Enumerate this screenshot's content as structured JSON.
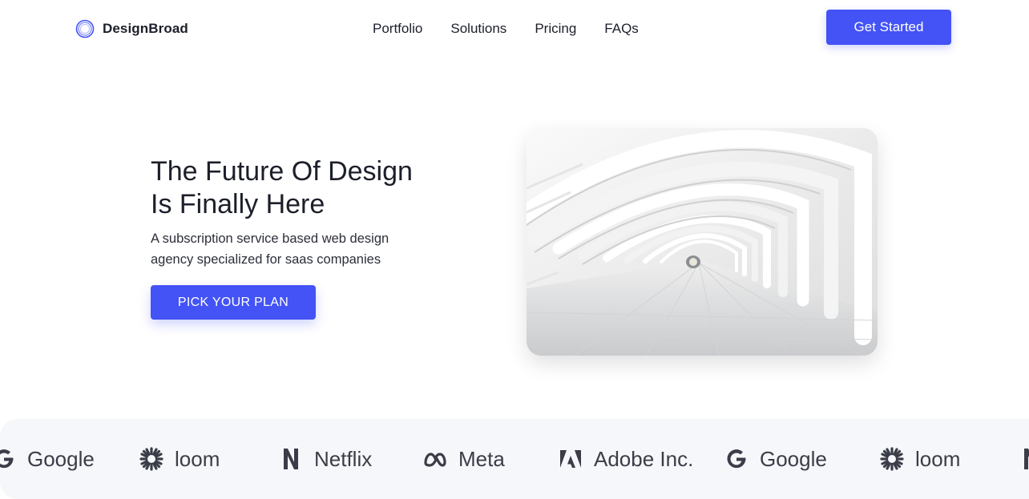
{
  "brand": {
    "name": "DesignBroad",
    "accent": "#4353f5"
  },
  "nav": {
    "links": [
      "Portfolio",
      "Solutions",
      "Pricing",
      "FAQs"
    ],
    "cta": "Get Started"
  },
  "hero": {
    "title_line1": "The Future Of Design",
    "title_line2": "Is Finally Here",
    "subtitle_line1": "A subscription service based web design",
    "subtitle_line2": "agency specialized for saas companies",
    "cta": "PICK YOUR PLAN"
  },
  "logos": [
    {
      "name": "Google",
      "icon": "google-icon"
    },
    {
      "name": "loom",
      "icon": "loom-icon"
    },
    {
      "name": "Netflix",
      "icon": "netflix-icon"
    },
    {
      "name": "Meta",
      "icon": "meta-icon"
    },
    {
      "name": "Adobe Inc.",
      "icon": "adobe-icon"
    },
    {
      "name": "Google",
      "icon": "google-icon"
    },
    {
      "name": "loom",
      "icon": "loom-icon"
    }
  ]
}
